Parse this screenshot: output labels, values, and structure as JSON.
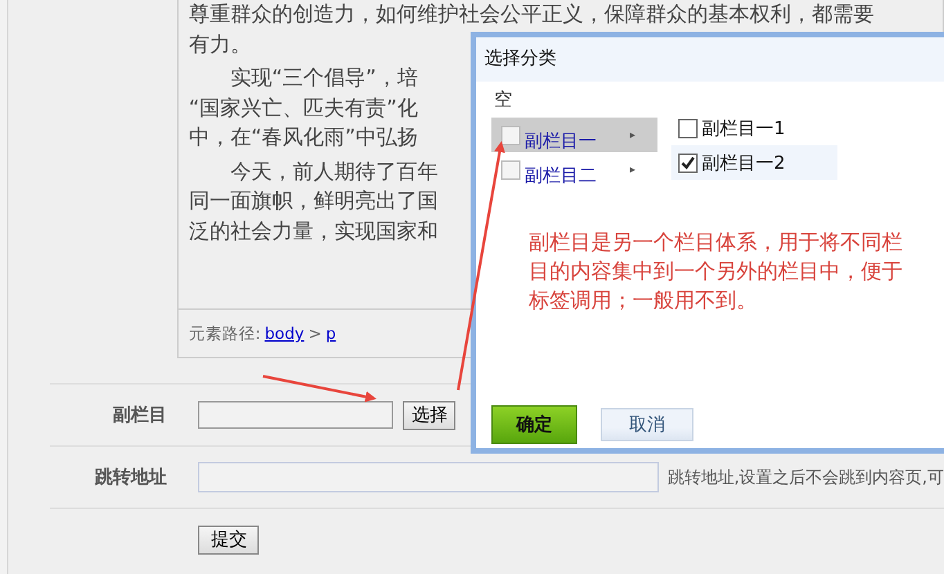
{
  "editor": {
    "paragraphs": [
      {
        "indent": false,
        "lines": [
          "尊重群众的创造力，如何维护社会公平正义，保障群众的基本权利，都需要",
          "有力。"
        ]
      },
      {
        "indent": true,
        "lines": [
          "实现“三个倡导”，培",
          "“国家兴亡、匹夫有责”化",
          "中，在“春风化雨”中弘扬"
        ]
      },
      {
        "indent": true,
        "lines": [
          "今天，前人期待了百年",
          "同一面旗帜，鲜明亮出了国",
          "泛的社会力量，实现国家和"
        ]
      }
    ],
    "path_label": "元素路径:",
    "path": [
      {
        "text": "body"
      },
      {
        "text": "p"
      }
    ],
    "path_separator": ">"
  },
  "form": {
    "sub_column": {
      "label": "副栏目",
      "button": "选择"
    },
    "redirect": {
      "label": "跳转地址",
      "help": "跳转地址,设置之后不会跳到内容页,可"
    },
    "submit": "提交"
  },
  "dialog": {
    "title": "选择分类",
    "empty_option": "空",
    "categories": [
      {
        "label": "副栏目一",
        "checked": false,
        "selected": true,
        "arrow": "▸"
      },
      {
        "label": "副栏目二",
        "checked": false,
        "selected": false,
        "arrow": "▸"
      }
    ],
    "subcategories": [
      {
        "label": "副栏目一1",
        "checked": false,
        "selected": false
      },
      {
        "label": "副栏目一2",
        "checked": true,
        "selected": true
      }
    ],
    "note": "副栏目是另一个栏目体系，用于将不同栏目的内容集中到一个另外的栏目中，便于标签调用；一般用不到。",
    "ok": "确定",
    "cancel": "取消"
  }
}
